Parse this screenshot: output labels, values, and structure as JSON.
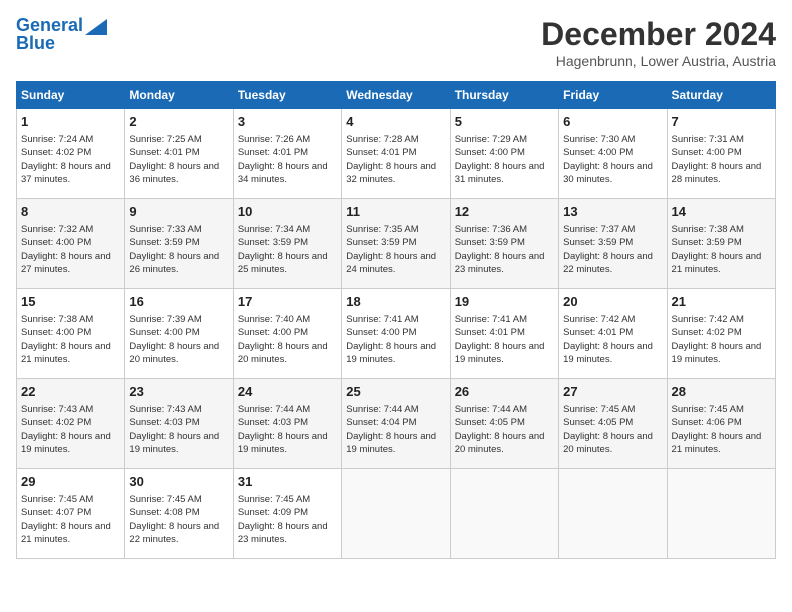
{
  "header": {
    "logo_line1": "General",
    "logo_line2": "Blue",
    "month": "December 2024",
    "location": "Hagenbrunn, Lower Austria, Austria"
  },
  "days_of_week": [
    "Sunday",
    "Monday",
    "Tuesday",
    "Wednesday",
    "Thursday",
    "Friday",
    "Saturday"
  ],
  "weeks": [
    [
      {
        "day": "1",
        "rise": "7:24 AM",
        "set": "4:02 PM",
        "daylight": "8 hours and 37 minutes"
      },
      {
        "day": "2",
        "rise": "7:25 AM",
        "set": "4:01 PM",
        "daylight": "8 hours and 36 minutes"
      },
      {
        "day": "3",
        "rise": "7:26 AM",
        "set": "4:01 PM",
        "daylight": "8 hours and 34 minutes"
      },
      {
        "day": "4",
        "rise": "7:28 AM",
        "set": "4:01 PM",
        "daylight": "8 hours and 32 minutes"
      },
      {
        "day": "5",
        "rise": "7:29 AM",
        "set": "4:00 PM",
        "daylight": "8 hours and 31 minutes"
      },
      {
        "day": "6",
        "rise": "7:30 AM",
        "set": "4:00 PM",
        "daylight": "8 hours and 30 minutes"
      },
      {
        "day": "7",
        "rise": "7:31 AM",
        "set": "4:00 PM",
        "daylight": "8 hours and 28 minutes"
      }
    ],
    [
      {
        "day": "8",
        "rise": "7:32 AM",
        "set": "4:00 PM",
        "daylight": "8 hours and 27 minutes"
      },
      {
        "day": "9",
        "rise": "7:33 AM",
        "set": "3:59 PM",
        "daylight": "8 hours and 26 minutes"
      },
      {
        "day": "10",
        "rise": "7:34 AM",
        "set": "3:59 PM",
        "daylight": "8 hours and 25 minutes"
      },
      {
        "day": "11",
        "rise": "7:35 AM",
        "set": "3:59 PM",
        "daylight": "8 hours and 24 minutes"
      },
      {
        "day": "12",
        "rise": "7:36 AM",
        "set": "3:59 PM",
        "daylight": "8 hours and 23 minutes"
      },
      {
        "day": "13",
        "rise": "7:37 AM",
        "set": "3:59 PM",
        "daylight": "8 hours and 22 minutes"
      },
      {
        "day": "14",
        "rise": "7:38 AM",
        "set": "3:59 PM",
        "daylight": "8 hours and 21 minutes"
      }
    ],
    [
      {
        "day": "15",
        "rise": "7:38 AM",
        "set": "4:00 PM",
        "daylight": "8 hours and 21 minutes"
      },
      {
        "day": "16",
        "rise": "7:39 AM",
        "set": "4:00 PM",
        "daylight": "8 hours and 20 minutes"
      },
      {
        "day": "17",
        "rise": "7:40 AM",
        "set": "4:00 PM",
        "daylight": "8 hours and 20 minutes"
      },
      {
        "day": "18",
        "rise": "7:41 AM",
        "set": "4:00 PM",
        "daylight": "8 hours and 19 minutes"
      },
      {
        "day": "19",
        "rise": "7:41 AM",
        "set": "4:01 PM",
        "daylight": "8 hours and 19 minutes"
      },
      {
        "day": "20",
        "rise": "7:42 AM",
        "set": "4:01 PM",
        "daylight": "8 hours and 19 minutes"
      },
      {
        "day": "21",
        "rise": "7:42 AM",
        "set": "4:02 PM",
        "daylight": "8 hours and 19 minutes"
      }
    ],
    [
      {
        "day": "22",
        "rise": "7:43 AM",
        "set": "4:02 PM",
        "daylight": "8 hours and 19 minutes"
      },
      {
        "day": "23",
        "rise": "7:43 AM",
        "set": "4:03 PM",
        "daylight": "8 hours and 19 minutes"
      },
      {
        "day": "24",
        "rise": "7:44 AM",
        "set": "4:03 PM",
        "daylight": "8 hours and 19 minutes"
      },
      {
        "day": "25",
        "rise": "7:44 AM",
        "set": "4:04 PM",
        "daylight": "8 hours and 19 minutes"
      },
      {
        "day": "26",
        "rise": "7:44 AM",
        "set": "4:05 PM",
        "daylight": "8 hours and 20 minutes"
      },
      {
        "day": "27",
        "rise": "7:45 AM",
        "set": "4:05 PM",
        "daylight": "8 hours and 20 minutes"
      },
      {
        "day": "28",
        "rise": "7:45 AM",
        "set": "4:06 PM",
        "daylight": "8 hours and 21 minutes"
      }
    ],
    [
      {
        "day": "29",
        "rise": "7:45 AM",
        "set": "4:07 PM",
        "daylight": "8 hours and 21 minutes"
      },
      {
        "day": "30",
        "rise": "7:45 AM",
        "set": "4:08 PM",
        "daylight": "8 hours and 22 minutes"
      },
      {
        "day": "31",
        "rise": "7:45 AM",
        "set": "4:09 PM",
        "daylight": "8 hours and 23 minutes"
      },
      null,
      null,
      null,
      null
    ]
  ]
}
